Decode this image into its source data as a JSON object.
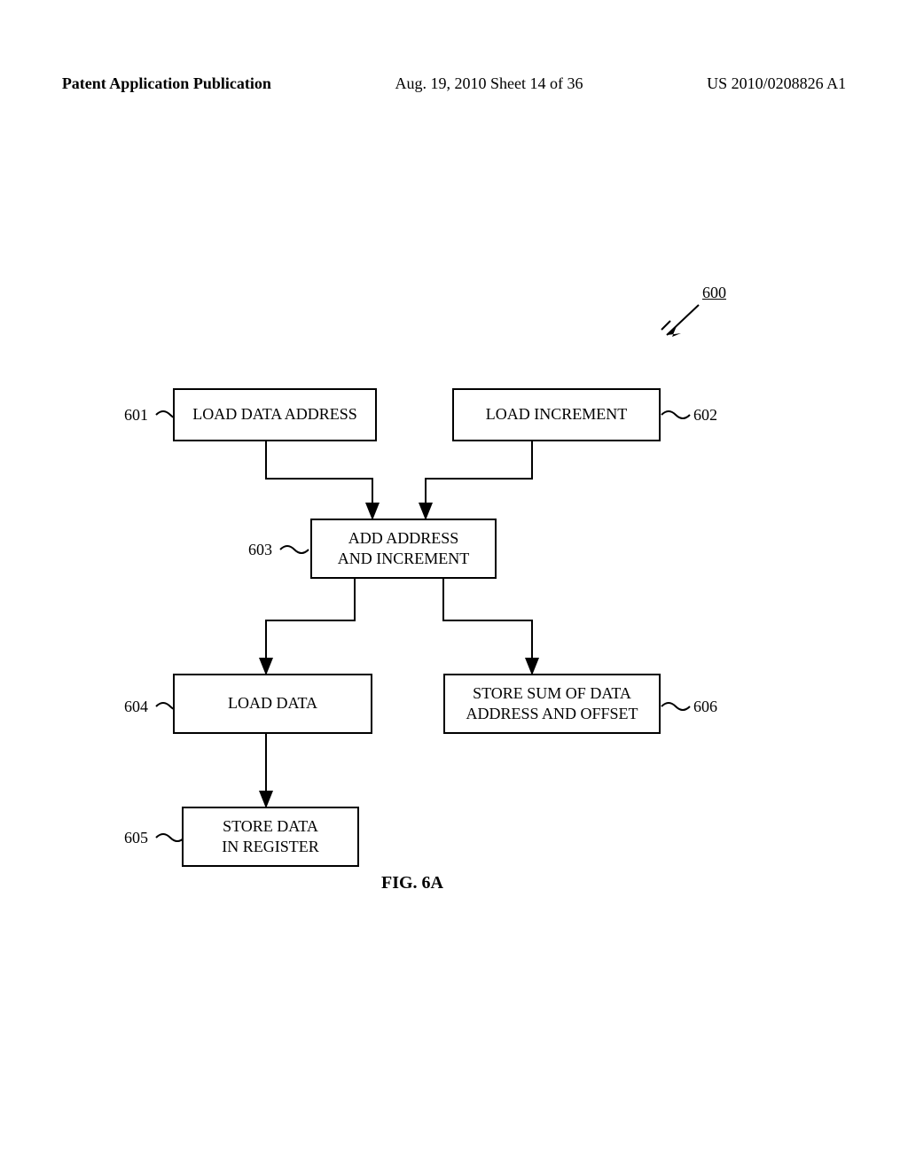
{
  "header": {
    "publication": "Patent Application Publication",
    "date_sheet": "Aug. 19, 2010  Sheet 14 of 36",
    "pubnum": "US 2010/0208826 A1"
  },
  "refs": {
    "r600": "600",
    "r601": "601",
    "r602": "602",
    "r603": "603",
    "r604": "604",
    "r605": "605",
    "r606": "606"
  },
  "boxes": {
    "b601": "LOAD DATA ADDRESS",
    "b602": "LOAD INCREMENT",
    "b603": "ADD ADDRESS\nAND INCREMENT",
    "b604": "LOAD DATA",
    "b605": "STORE DATA\nIN REGISTER",
    "b606": "STORE SUM OF DATA\nADDRESS AND OFFSET"
  },
  "figure": "FIG. 6A"
}
